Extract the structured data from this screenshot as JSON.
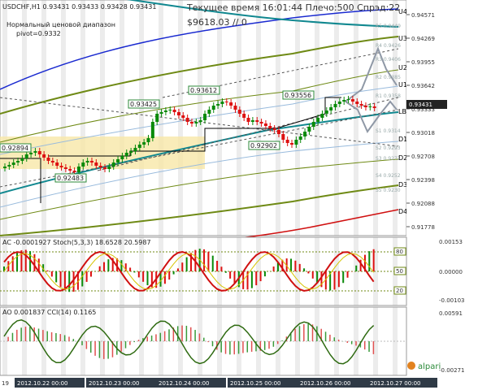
{
  "header": {
    "symbol_line": "USDCHF,H1  0.93431 0.93433 0.93428 0.93431",
    "server_time": "Текущее время 16:01:44 Плечо:500 Спрэд:22",
    "balance_line": "$9618.03    // 0",
    "indicator_name": "Нормальный ценовой диапазон",
    "pivot_line": "pivot=0.9332"
  },
  "price_axis": [
    "0.94571",
    "0.94269",
    "0.93955",
    "0.93642",
    "0.93333",
    "0.93018",
    "0.92708",
    "0.92398",
    "0.92088",
    "0.91778"
  ],
  "current_price": "0.93431",
  "bands": {
    "labels": [
      "U4",
      "U3",
      "U2",
      "U1",
      "LB",
      "D1",
      "D2",
      "D3",
      "D4"
    ]
  },
  "pivot_labels": [
    "R5 0.9449",
    "R4 0.9426",
    "R3 0.9406",
    "R2 0.9385",
    "R1 0.9358",
    "S1 0.9314",
    "S2 0.9293",
    "S3 0.9272",
    "S4 0.9252",
    "S5 0.9230"
  ],
  "price_annotations": [
    "0.92894",
    "0.92483",
    "0.93425",
    "0.93612",
    "0.92902",
    "0.93556"
  ],
  "ac_panel": {
    "title": "AC -0.0001927  Stoch(5,3,3)  18.6528  20.5987",
    "scale": [
      "0.00153",
      "0.00000",
      "-0.00103"
    ],
    "levels": [
      "80",
      "50",
      "20"
    ]
  },
  "ao_panel": {
    "title": "AO  0.001837  CCI(14)  0.1165",
    "scale": [
      "0.00591",
      "-0.00271"
    ],
    "brand": "alpari"
  },
  "time_axis": [
    "19",
    "2012.10.22 00:00",
    "2012.10.23 00:00",
    "2012.10.24 00:00",
    "2012.10.25 00:00",
    "2012.10.26 00:00",
    "2012.10.27 00:00"
  ],
  "colors": {
    "up": "#0a8a0a",
    "down": "#d11",
    "ma": "#118890",
    "band_outer": "#1a2ad0",
    "band_inner": "#6f8a15",
    "d4": "#d01010"
  }
}
